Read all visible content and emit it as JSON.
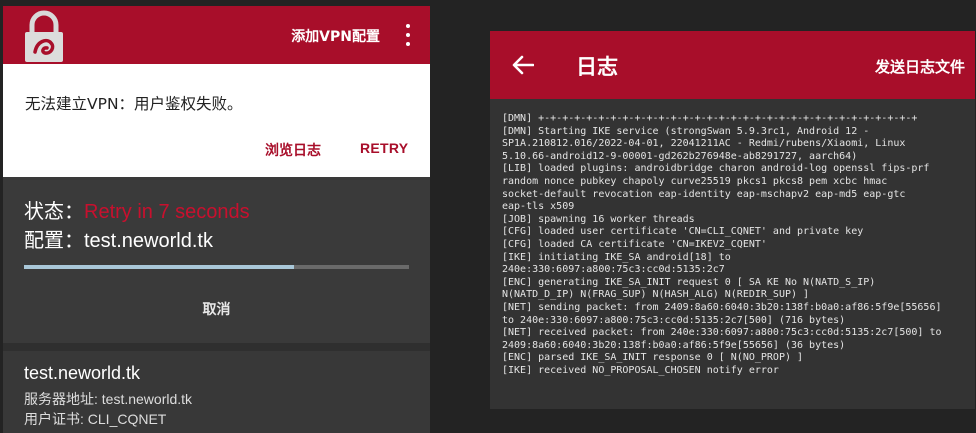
{
  "left": {
    "header": {
      "add_vpn_label": "添加VPN配置"
    },
    "dialog": {
      "message": "无法建立VPN：用户鉴权失败。",
      "browse_log_label": "浏览日志",
      "retry_label": "RETRY"
    },
    "status": {
      "status_label": "状态：",
      "status_value": "Retry in 7 seconds",
      "profile_label": "配置：",
      "profile_value": "test.neworld.tk",
      "progress": 0.7,
      "cancel_label": "取消"
    },
    "profile_card": {
      "name": "test.neworld.tk",
      "server_row": "服务器地址: test.neworld.tk",
      "cert_row": "用户证书: CLI_CQNET"
    }
  },
  "right": {
    "header": {
      "title": "日志",
      "send_log_label": "发送日志文件"
    },
    "log_lines": [
      "[DMN] +-+-+-+-+-+-+-+-+-+-+-+-+-+-+-+-+-+-+-+-+-+-+-+-+-+-+-+-+-+-+-+",
      "[DMN] Starting IKE service (strongSwan 5.9.3rc1, Android 12 -",
      "SP1A.210812.016/2022-04-01, 22041211AC - Redmi/rubens/Xiaomi, Linux",
      "5.10.66-android12-9-00001-gd262b276948e-ab8291727, aarch64)",
      "[LIB] loaded plugins: androidbridge charon android-log openssl fips-prf",
      "random nonce pubkey chapoly curve25519 pkcs1 pkcs8 pem xcbc hmac",
      "socket-default revocation eap-identity eap-mschapv2 eap-md5 eap-gtc",
      "eap-tls x509",
      "[JOB] spawning 16 worker threads",
      "[CFG] loaded user certificate 'CN=CLI_CQNET' and private key",
      "[CFG] loaded CA certificate 'CN=IKEV2_CQENT'",
      "[IKE] initiating IKE_SA android[18] to",
      "240e:330:6097:a800:75c3:cc0d:5135:2c7",
      "[ENC] generating IKE_SA_INIT request 0 [ SA KE No N(NATD_S_IP)",
      "N(NATD_D_IP) N(FRAG_SUP) N(HASH_ALG) N(REDIR_SUP) ]",
      "[NET] sending packet: from 2409:8a60:6040:3b20:138f:b0a0:af86:5f9e[55656]",
      "to 240e:330:6097:a800:75c3:cc0d:5135:2c7[500] (716 bytes)",
      "[NET] received packet: from 240e:330:6097:a800:75c3:cc0d:5135:2c7[500] to",
      "2409:8a60:6040:3b20:138f:b0a0:af86:5f9e[55656] (36 bytes)",
      "[ENC] parsed IKE_SA_INIT response 0 [ N(NO_PROP) ]",
      "[IKE] received NO_PROPOSAL_CHOSEN notify error"
    ]
  },
  "colors": {
    "brand_red": "#a80e2a",
    "status_red": "#c8102e",
    "progress_blue": "#a9c7d8"
  },
  "icons": [
    "lock-logo-icon",
    "more-vert-icon",
    "arrow-back-icon"
  ]
}
